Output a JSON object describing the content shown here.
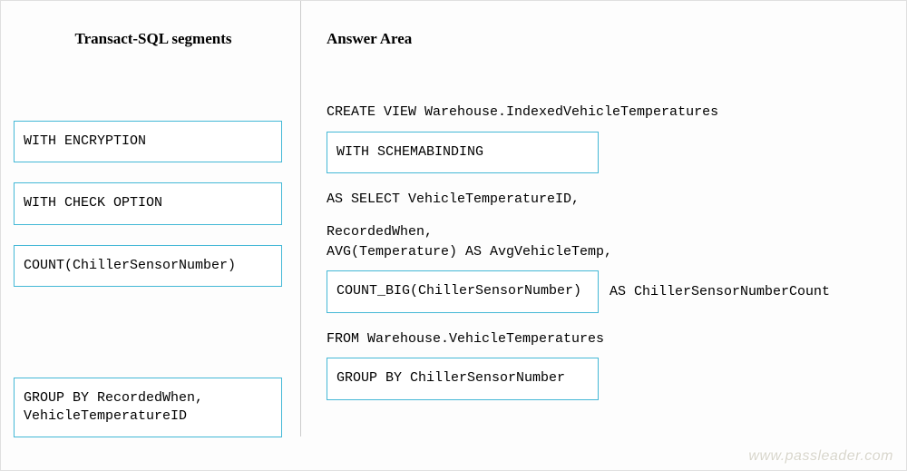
{
  "headings": {
    "left": "Transact-SQL segments",
    "right": "Answer Area"
  },
  "left_segments": [
    "WITH ENCRYPTION",
    "WITH CHECK OPTION",
    "COUNT(ChillerSensorNumber)",
    "GROUP BY RecordedWhen,\nVehicleTemperatureID"
  ],
  "answer": {
    "line1": "CREATE VIEW Warehouse.IndexedVehicleTemperatures",
    "drop1": "WITH SCHEMABINDING",
    "line2": "AS SELECT VehicleTemperatureID,",
    "line3": "RecordedWhen,\nAVG(Temperature) AS AvgVehicleTemp,",
    "drop2": "COUNT_BIG(ChillerSensorNumber)",
    "drop2_suffix": "AS ChillerSensorNumberCount",
    "line4": "FROM Warehouse.VehicleTemperatures",
    "drop3": "GROUP BY ChillerSensorNumber"
  },
  "watermark": "www.passleader.com"
}
